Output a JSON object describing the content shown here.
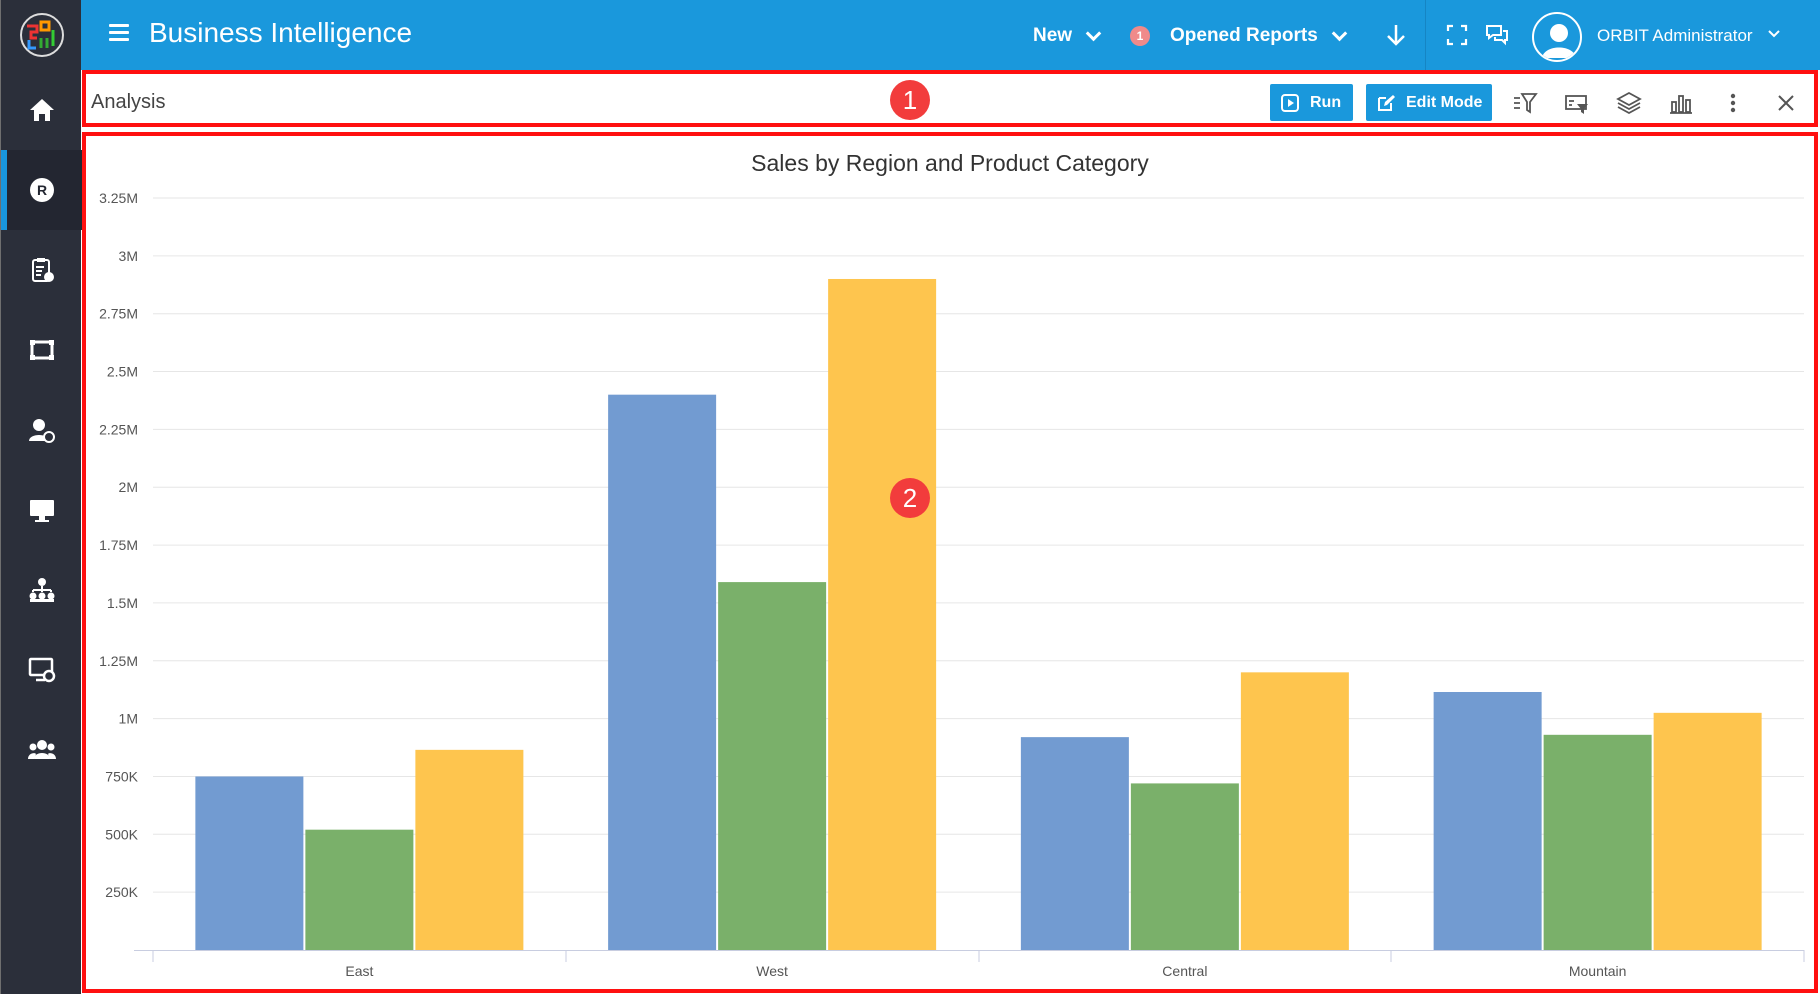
{
  "app": {
    "title": "Business Intelligence"
  },
  "topbar": {
    "new_label": "New",
    "opened_reports_label": "Opened Reports",
    "opened_reports_count": "1",
    "user_name": "ORBIT Administrator"
  },
  "sidebar": {
    "items": [
      {
        "icon": "home-icon"
      },
      {
        "icon": "reports-icon",
        "active": true
      },
      {
        "icon": "clipboard-icon"
      },
      {
        "icon": "dashboard-icon"
      },
      {
        "icon": "user-settings-icon"
      },
      {
        "icon": "monitor-icon"
      },
      {
        "icon": "org-chart-icon"
      },
      {
        "icon": "display-settings-icon"
      },
      {
        "icon": "users-group-icon"
      }
    ]
  },
  "toolbar": {
    "section_title": "Analysis",
    "run_label": "Run",
    "edit_mode_label": "Edit Mode",
    "markers": [
      "1",
      "2"
    ]
  },
  "colors": {
    "brand": "#1a98dc",
    "sidebar": "#2b2f3a",
    "highlight": "#ff1010"
  },
  "chart_data": {
    "type": "bar",
    "title": "Sales by Region and Product Category",
    "categories": [
      "East",
      "West",
      "Central",
      "Mountain"
    ],
    "series": [
      {
        "color": "#729bd1",
        "values": [
          750000,
          2400000,
          920000,
          1115000
        ]
      },
      {
        "color": "#7ab06a",
        "values": [
          520000,
          1590000,
          720000,
          930000
        ]
      },
      {
        "color": "#fec54e",
        "values": [
          865000,
          2900000,
          1200000,
          1025000
        ]
      }
    ],
    "y_ticks": [
      "250K",
      "500K",
      "750K",
      "1M",
      "1.25M",
      "1.5M",
      "1.75M",
      "2M",
      "2.25M",
      "2.5M",
      "2.75M",
      "3M",
      "3.25M"
    ],
    "ylim": [
      0,
      3250000
    ],
    "grid": true
  }
}
